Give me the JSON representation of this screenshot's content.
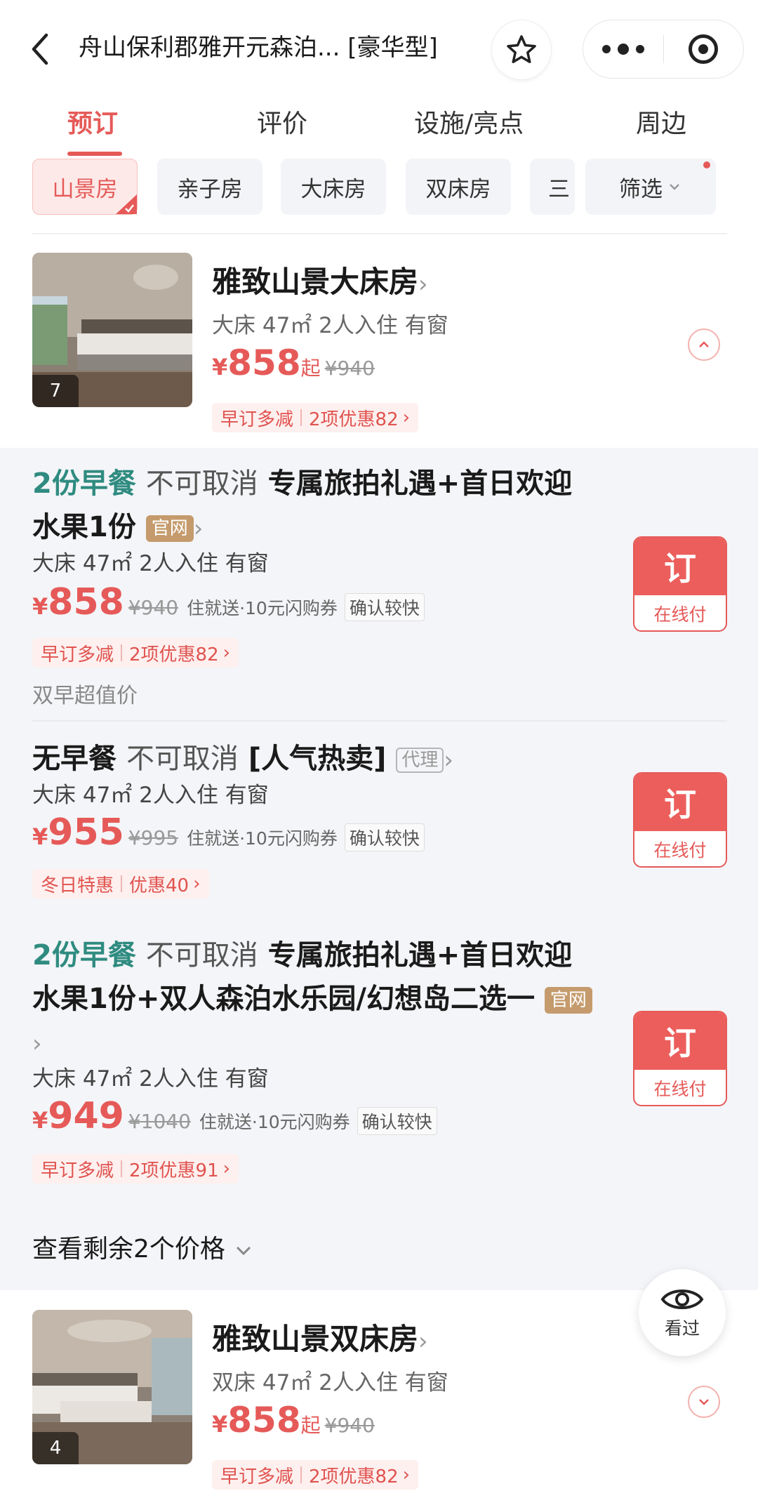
{
  "header": {
    "title": "舟山保利郡雅开元森泊... [豪华型]",
    "icons": {
      "back": "back-arrow-icon",
      "favorite": "star-icon",
      "more": "more-dots-icon",
      "close": "target-icon"
    }
  },
  "tabs": [
    {
      "label": "预订",
      "active": true
    },
    {
      "label": "评价",
      "active": false
    },
    {
      "label": "设施/亮点",
      "active": false
    },
    {
      "label": "周边",
      "active": false
    }
  ],
  "filters": {
    "chips": [
      {
        "label": "山景房",
        "active": true
      },
      {
        "label": "亲子房",
        "active": false
      },
      {
        "label": "大床房",
        "active": false
      },
      {
        "label": "双床房",
        "active": false
      },
      {
        "label": "三",
        "active": false
      }
    ],
    "filter_label": "筛选"
  },
  "rooms": [
    {
      "name": "雅致山景大床房",
      "meta": "大床 47㎡ 2人入住 有窗",
      "currency": "¥",
      "price": "858",
      "price_suffix": "起",
      "original_price": "¥940",
      "photo_count": "7",
      "promo_a": "早订多减",
      "promo_b": "2项优惠82",
      "expanded": true
    },
    {
      "name": "雅致山景双床房",
      "meta": "双床 47㎡ 2人入住 有窗",
      "currency": "¥",
      "price": "858",
      "price_suffix": "起",
      "original_price": "¥940",
      "photo_count": "4",
      "promo_a": "早订多减",
      "promo_b": "2项优惠82",
      "expanded": false
    }
  ],
  "plans": [
    {
      "breakfast": "2份早餐",
      "cancel": "不可取消",
      "title": "专属旅拍礼遇+首日欢迎水果1份",
      "tag": "官网",
      "meta": "大床 47㎡ 2人入住 有窗",
      "currency": "¥",
      "price": "858",
      "original_price": "¥940",
      "perks": "住就送·10元闪购券",
      "confirm": "确认较快",
      "promo_a": "早订多减",
      "promo_b": "2项优惠82",
      "note": "双早超值价",
      "book": "订",
      "pay": "在线付"
    },
    {
      "breakfast": "无早餐",
      "cancel": "不可取消",
      "title": "[人气热卖]",
      "tag": "代理",
      "meta": "大床 47㎡ 2人入住 有窗",
      "currency": "¥",
      "price": "955",
      "original_price": "¥995",
      "perks": "住就送·10元闪购券",
      "confirm": "确认较快",
      "promo_a": "冬日特惠",
      "promo_b": "优惠40",
      "book": "订",
      "pay": "在线付"
    },
    {
      "breakfast": "2份早餐",
      "cancel": "不可取消",
      "title": "专属旅拍礼遇+首日欢迎水果1份+双人森泊水乐园/幻想岛二选一",
      "tag": "官网",
      "meta": "大床 47㎡ 2人入住 有窗",
      "currency": "¥",
      "price": "949",
      "original_price": "¥1040",
      "perks": "住就送·10元闪购券",
      "confirm": "确认较快",
      "promo_a": "早订多减",
      "promo_b": "2项优惠91",
      "book": "订",
      "pay": "在线付"
    }
  ],
  "more_prices": "查看剩余2个价格",
  "float": {
    "label": "看过",
    "icon": "eye-icon"
  },
  "colors": {
    "accent": "#e55a58",
    "teal": "#2f8b80",
    "gold_tag": "#c59b6d",
    "section_bg": "#f4f5f8"
  }
}
